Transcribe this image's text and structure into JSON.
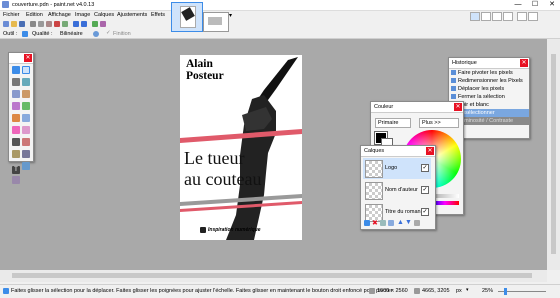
{
  "window": {
    "title": "couverture.pdn - paint.net v4.0.13",
    "minimize": "—",
    "maximize": "☐",
    "close": "✕"
  },
  "menu": [
    "Fichier",
    "Edition",
    "Affichage",
    "Image",
    "Calques",
    "Ajustements",
    "Effets"
  ],
  "toolbar": {
    "tool_label": "Outil :",
    "quality_label": "Qualité :",
    "quality_value": "Bilinéaire",
    "finish_label": "Finition"
  },
  "document": {
    "author": "Alain\nPosteur",
    "title": "Le tueur\nau couteau",
    "publisher": "Inspiration numérique"
  },
  "history": {
    "title": "Historique",
    "items": [
      "Faire pivoter les pixels",
      "Redimensionner les Pixels",
      "Déplacer les pixels",
      "Fermer la sélection",
      "Noir et blanc",
      "Désélectionner",
      "Luminosité / Contraste"
    ]
  },
  "color_panel": {
    "title": "Couleur",
    "primary": "Primaire",
    "more": "Plus >>"
  },
  "layers": {
    "title": "Calques",
    "items": [
      {
        "name": "Logo",
        "visible": true
      },
      {
        "name": "Nom d'auteur",
        "visible": true
      },
      {
        "name": "Titre du roman",
        "visible": true
      }
    ]
  },
  "status": {
    "hint": "Faites glisser la sélection pour la déplacer. Faites glisser les poignées pour ajuster l'échelle. Faites glisser en maintenant le bouton droit enfoncé pour pivoter.",
    "size": "1600 × 2560",
    "position": "4665, 3205",
    "unit": "px",
    "zoom": "25%"
  },
  "colors": {
    "accent": "#3c8ce8",
    "selected_history": "#7aa7e0",
    "stripe": "#e05a6a"
  }
}
